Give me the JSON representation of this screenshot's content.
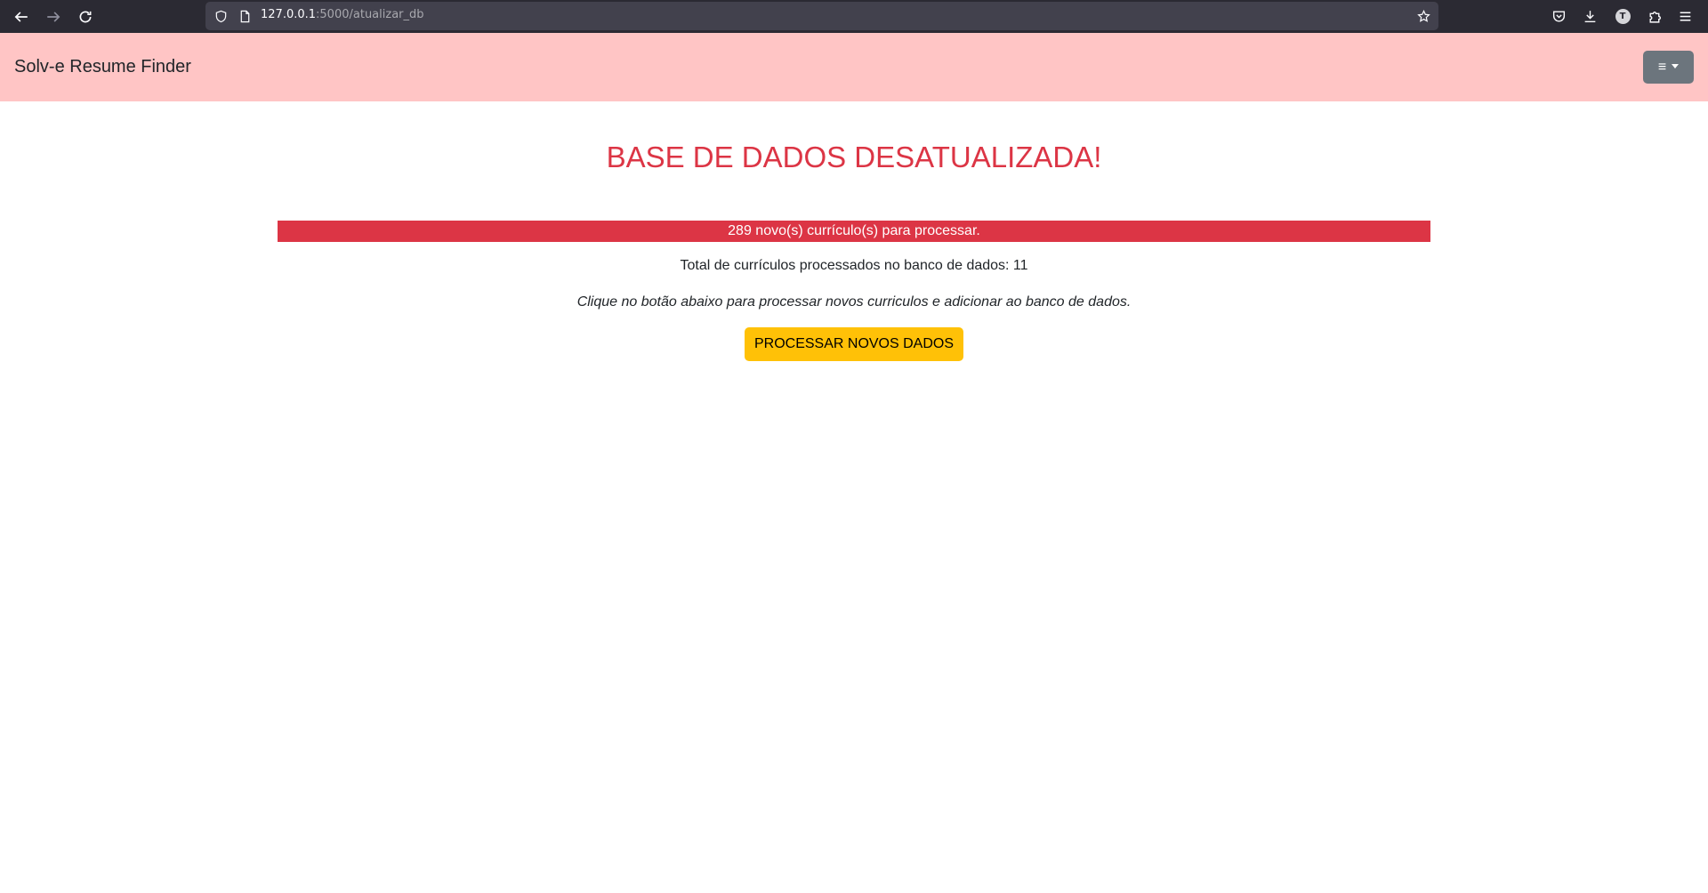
{
  "browser": {
    "url_host": "127.0.0.1",
    "url_path": ":5000/atualizar_db",
    "avatar_letter": "T",
    "icons": {
      "back": "arrow-left-icon",
      "forward": "arrow-right-icon",
      "reload": "reload-icon",
      "shield": "shield-icon",
      "page": "page-icon",
      "bookmark": "star-icon",
      "pocket": "pocket-icon",
      "downloads": "download-icon",
      "account": "account-avatar-icon",
      "extensions": "puzzle-icon",
      "menu": "hamburger-menu-icon"
    }
  },
  "navbar": {
    "brand": "Solv-e Resume Finder",
    "menu_icon": "≡",
    "background_color": "#ffc5c5",
    "menu_button_color": "#6c757d"
  },
  "main": {
    "title": "BASE DE DADOS DESATUALIZADA!",
    "alert": "289 novo(s) currículo(s) para processar.",
    "total": "Total de currículos processados no banco de dados: 11",
    "hint": "Clique no botão abaixo para processar novos curriculos e adicionar ao banco de dados.",
    "button_label": "PROCESSAR NOVOS DADOS",
    "title_color": "#dc3545",
    "alert_color": "#dc3545",
    "button_color": "#ffc107"
  }
}
